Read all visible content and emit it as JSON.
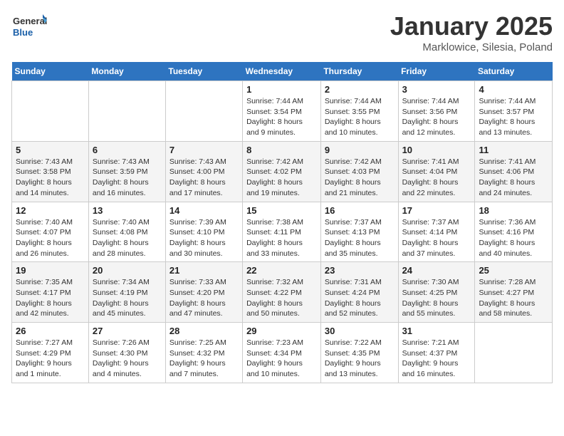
{
  "header": {
    "logo_general": "General",
    "logo_blue": "Blue",
    "title": "January 2025",
    "subtitle": "Marklowice, Silesia, Poland"
  },
  "days_of_week": [
    "Sunday",
    "Monday",
    "Tuesday",
    "Wednesday",
    "Thursday",
    "Friday",
    "Saturday"
  ],
  "weeks": [
    [
      {
        "day": "",
        "info": ""
      },
      {
        "day": "",
        "info": ""
      },
      {
        "day": "",
        "info": ""
      },
      {
        "day": "1",
        "info": "Sunrise: 7:44 AM\nSunset: 3:54 PM\nDaylight: 8 hours\nand 9 minutes."
      },
      {
        "day": "2",
        "info": "Sunrise: 7:44 AM\nSunset: 3:55 PM\nDaylight: 8 hours\nand 10 minutes."
      },
      {
        "day": "3",
        "info": "Sunrise: 7:44 AM\nSunset: 3:56 PM\nDaylight: 8 hours\nand 12 minutes."
      },
      {
        "day": "4",
        "info": "Sunrise: 7:44 AM\nSunset: 3:57 PM\nDaylight: 8 hours\nand 13 minutes."
      }
    ],
    [
      {
        "day": "5",
        "info": "Sunrise: 7:43 AM\nSunset: 3:58 PM\nDaylight: 8 hours\nand 14 minutes."
      },
      {
        "day": "6",
        "info": "Sunrise: 7:43 AM\nSunset: 3:59 PM\nDaylight: 8 hours\nand 16 minutes."
      },
      {
        "day": "7",
        "info": "Sunrise: 7:43 AM\nSunset: 4:00 PM\nDaylight: 8 hours\nand 17 minutes."
      },
      {
        "day": "8",
        "info": "Sunrise: 7:42 AM\nSunset: 4:02 PM\nDaylight: 8 hours\nand 19 minutes."
      },
      {
        "day": "9",
        "info": "Sunrise: 7:42 AM\nSunset: 4:03 PM\nDaylight: 8 hours\nand 21 minutes."
      },
      {
        "day": "10",
        "info": "Sunrise: 7:41 AM\nSunset: 4:04 PM\nDaylight: 8 hours\nand 22 minutes."
      },
      {
        "day": "11",
        "info": "Sunrise: 7:41 AM\nSunset: 4:06 PM\nDaylight: 8 hours\nand 24 minutes."
      }
    ],
    [
      {
        "day": "12",
        "info": "Sunrise: 7:40 AM\nSunset: 4:07 PM\nDaylight: 8 hours\nand 26 minutes."
      },
      {
        "day": "13",
        "info": "Sunrise: 7:40 AM\nSunset: 4:08 PM\nDaylight: 8 hours\nand 28 minutes."
      },
      {
        "day": "14",
        "info": "Sunrise: 7:39 AM\nSunset: 4:10 PM\nDaylight: 8 hours\nand 30 minutes."
      },
      {
        "day": "15",
        "info": "Sunrise: 7:38 AM\nSunset: 4:11 PM\nDaylight: 8 hours\nand 33 minutes."
      },
      {
        "day": "16",
        "info": "Sunrise: 7:37 AM\nSunset: 4:13 PM\nDaylight: 8 hours\nand 35 minutes."
      },
      {
        "day": "17",
        "info": "Sunrise: 7:37 AM\nSunset: 4:14 PM\nDaylight: 8 hours\nand 37 minutes."
      },
      {
        "day": "18",
        "info": "Sunrise: 7:36 AM\nSunset: 4:16 PM\nDaylight: 8 hours\nand 40 minutes."
      }
    ],
    [
      {
        "day": "19",
        "info": "Sunrise: 7:35 AM\nSunset: 4:17 PM\nDaylight: 8 hours\nand 42 minutes."
      },
      {
        "day": "20",
        "info": "Sunrise: 7:34 AM\nSunset: 4:19 PM\nDaylight: 8 hours\nand 45 minutes."
      },
      {
        "day": "21",
        "info": "Sunrise: 7:33 AM\nSunset: 4:20 PM\nDaylight: 8 hours\nand 47 minutes."
      },
      {
        "day": "22",
        "info": "Sunrise: 7:32 AM\nSunset: 4:22 PM\nDaylight: 8 hours\nand 50 minutes."
      },
      {
        "day": "23",
        "info": "Sunrise: 7:31 AM\nSunset: 4:24 PM\nDaylight: 8 hours\nand 52 minutes."
      },
      {
        "day": "24",
        "info": "Sunrise: 7:30 AM\nSunset: 4:25 PM\nDaylight: 8 hours\nand 55 minutes."
      },
      {
        "day": "25",
        "info": "Sunrise: 7:28 AM\nSunset: 4:27 PM\nDaylight: 8 hours\nand 58 minutes."
      }
    ],
    [
      {
        "day": "26",
        "info": "Sunrise: 7:27 AM\nSunset: 4:29 PM\nDaylight: 9 hours\nand 1 minute."
      },
      {
        "day": "27",
        "info": "Sunrise: 7:26 AM\nSunset: 4:30 PM\nDaylight: 9 hours\nand 4 minutes."
      },
      {
        "day": "28",
        "info": "Sunrise: 7:25 AM\nSunset: 4:32 PM\nDaylight: 9 hours\nand 7 minutes."
      },
      {
        "day": "29",
        "info": "Sunrise: 7:23 AM\nSunset: 4:34 PM\nDaylight: 9 hours\nand 10 minutes."
      },
      {
        "day": "30",
        "info": "Sunrise: 7:22 AM\nSunset: 4:35 PM\nDaylight: 9 hours\nand 13 minutes."
      },
      {
        "day": "31",
        "info": "Sunrise: 7:21 AM\nSunset: 4:37 PM\nDaylight: 9 hours\nand 16 minutes."
      },
      {
        "day": "",
        "info": ""
      }
    ]
  ]
}
